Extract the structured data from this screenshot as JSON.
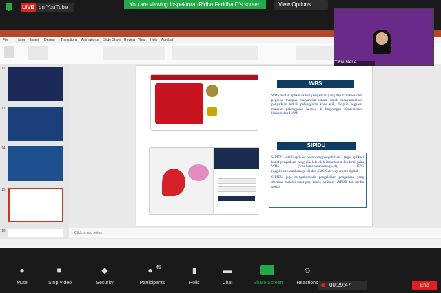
{
  "zoom_top": {
    "live_label": "LIVE",
    "live_platform": "on YouTube",
    "banner": "You are viewing Inspektorat-Ridha Faridha D's screen",
    "view_options": "View Options"
  },
  "participant": {
    "name": "IT/EN-MALA"
  },
  "ppt": {
    "tabs": [
      "File",
      "Home",
      "Insert",
      "Design",
      "Transitions",
      "Animations",
      "Slide Show",
      "Review",
      "View",
      "Help",
      "Acrobat"
    ],
    "notes_placeholder": "Click to add notes",
    "slide_numbers": [
      "12",
      "13",
      "14",
      "15",
      "16"
    ]
  },
  "slide": {
    "wbs_title": "WBS",
    "wbs_text": "WBS adalah aplikasi kanal pengaduan yang dapat diakses oleh pegawai maupun masyarakat umum untuk menyampaikan pengaduan terkait pelanggaran kode etik, disiplin pegawai maupun pelanggaran lainnya di lingkungan Kementerian Hukum dan HAM.",
    "sipidu_title": "SIPIDU",
    "sipidu_text1": "SIPIDU adalah aplikasi penunjang pengelolaan 3 (tiga) aplikasi kanal pengaduan yang dikelola oleh Inspektorat Jenderal yaitu WBS (wbs.kemenkumham.go.id), UPG (upg.kemenkumham.go.id) dan SMS Gateway secara digital.",
    "sipidu_text2": "SIPIDU juga mengakomodir pengelolaan pengaduan yang diterima melalui surat pos, email, aplikasi LAPOR dan media sosial."
  },
  "zoom_bottom": {
    "buttons": [
      "Mute",
      "Stop Video",
      "Security",
      "Participants",
      "Polls",
      "Chat",
      "Share Screen",
      "Reactions"
    ],
    "participants_count": "45",
    "timer": "00:29:47",
    "end_label": "End"
  },
  "colors": {
    "ppt_brand": "#b7472a",
    "live_red": "#e02020",
    "zoom_green": "#23a94a",
    "slide_header": "#0f3d61"
  }
}
